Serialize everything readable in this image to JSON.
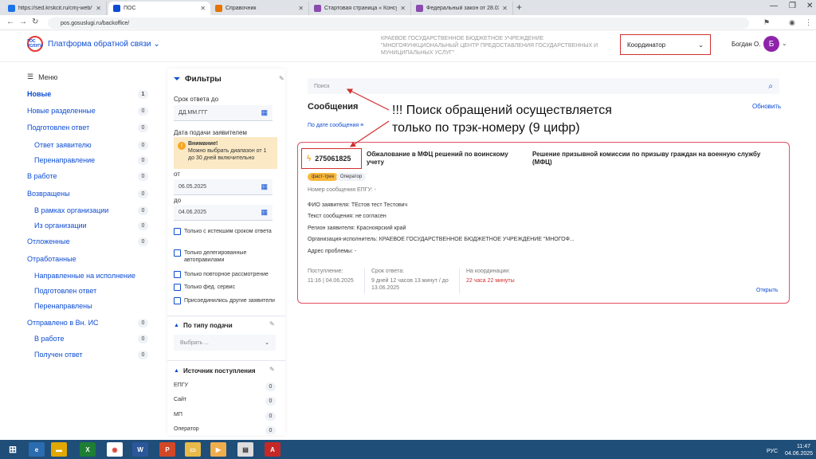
{
  "browser": {
    "tabs": [
      {
        "title": "https://sed.krskcit.ru/cmj-web/та",
        "color": "#1a73e8"
      },
      {
        "title": "ПОС",
        "color": "#0d4cd3"
      },
      {
        "title": "Справочник",
        "color": "#e37400"
      },
      {
        "title": "Стартовая страница « Консуль",
        "color": "#8a4baf"
      },
      {
        "title": "Федеральный закон от 28.03.19",
        "color": "#8a4baf"
      }
    ],
    "url": "pos.gosuslugi.ru/backoffice/"
  },
  "header": {
    "logo_text": "ГОС УСЛУГИ",
    "platform": "Платформа обратной связи",
    "org": "КРАЕВОЕ ГОСУДАРСТВЕННОЕ БЮДЖЕТНОЕ УЧРЕЖДЕНИЕ \"МНОГОФУНКЦИОНАЛЬНЫЙ ЦЕНТР ПРЕДОСТАВЛЕНИЯ ГОСУДАРСТВЕННЫХ И МУНИЦИПАЛЬНЫХ УСЛУГ\"",
    "role": "Координатор",
    "user": "Богдан О.",
    "avatar_letter": "Б"
  },
  "sidebar": {
    "menu_label": "Меню",
    "items": [
      {
        "label": "Новые",
        "count": "1"
      },
      {
        "label": "Новые разделенные",
        "count": "0"
      },
      {
        "label": "Подготовлен ответ",
        "count": "0"
      },
      {
        "label": "Ответ заявителю",
        "count": "0"
      },
      {
        "label": "Перенаправление",
        "count": "0"
      },
      {
        "label": "В работе",
        "count": "0"
      },
      {
        "label": "Возвращены",
        "count": "0"
      },
      {
        "label": "В рамках организации",
        "count": "0"
      },
      {
        "label": "Из организации",
        "count": "0"
      },
      {
        "label": "Отложенные",
        "count": "0"
      },
      {
        "label": "Отработанные",
        "count": ""
      },
      {
        "label": "Направленные на исполнение",
        "count": ""
      },
      {
        "label": "Подготовлен ответ",
        "count": ""
      },
      {
        "label": "Перенаправлены",
        "count": ""
      },
      {
        "label": "Отправлено в Вн. ИС",
        "count": "0"
      },
      {
        "label": "В работе",
        "count": "0"
      },
      {
        "label": "Получен ответ",
        "count": "0"
      }
    ]
  },
  "filters": {
    "title": "Фильтры",
    "deadline_label": "Срок ответа до",
    "deadline_placeholder": "ДД.ММ.ГГГ",
    "submit_date_label": "Дата подачи заявителем",
    "warning_title": "Внимание!",
    "warning_text": "Можно выбрать диапазон от 1 до 30 дней включительно",
    "from_label": "от",
    "from_value": "06.05.2025",
    "to_label": "до",
    "to_value": "04.06.2025",
    "checkboxes": [
      "Только с истекшим сроком ответа",
      "Только делегированные автоправилами",
      "Только повторное рассмотрение",
      "Только фед. сервис",
      "Присоединились другие заявители"
    ],
    "type_title": "По типу подачи",
    "type_placeholder": "Выбрать ...",
    "source_title": "Источник поступления",
    "sources": [
      {
        "label": "ЕПГУ",
        "count": "0"
      },
      {
        "label": "Сайт",
        "count": "0"
      },
      {
        "label": "МП",
        "count": "0"
      },
      {
        "label": "Оператор",
        "count": "0"
      }
    ]
  },
  "main": {
    "search_placeholder": "Поиск",
    "title": "Сообщения",
    "refresh": "Обновить",
    "sort": "По дате сообщения",
    "annotation": "!!! Поиск обращений осуществляется только по трэк-номеру (9 цифр)",
    "card": {
      "track_number": "275061825",
      "title": "Обжалование в МФЦ решений по воинскому учету",
      "subtitle": "Решение призывной комиссии по призыву граждан на военную службу (МФЦ)",
      "tag_fast": "фаст-трек",
      "tag_operator": "Оператор",
      "epgu_number": "Номер сообщения ЕПГУ:  -",
      "fio": "ФИО заявителя: ТЕстов тест Тестович",
      "text": "Текст сообщения: не согласен",
      "region": "Регион заявителя: Красноярский край",
      "org": "Организация-исполнитель: КРАЕВОЕ ГОСУДАРСТВЕННОЕ БЮДЖЕТНОЕ УЧРЕЖДЕНИЕ \"МНОГОФ...",
      "address": "Адрес проблемы: -",
      "received_label": "Поступление:",
      "received_value": "11:16 | 04.06.2025",
      "deadline_label": "Срок ответа:",
      "deadline_value": "9 дней 12 часов 13 минут / до 13.06.2025",
      "coord_label": "На координации:",
      "coord_value": "22 часа 22 минуты",
      "open": "Открыть"
    }
  },
  "taskbar": {
    "lang": "РУС",
    "time": "11:47",
    "date": "04.06.2025"
  },
  "colors": {
    "accent": "#0d4cd3",
    "highlight_red": "#d32f2f",
    "warning_bg": "#fbe9c5",
    "taskbar": "#1f4e79"
  }
}
